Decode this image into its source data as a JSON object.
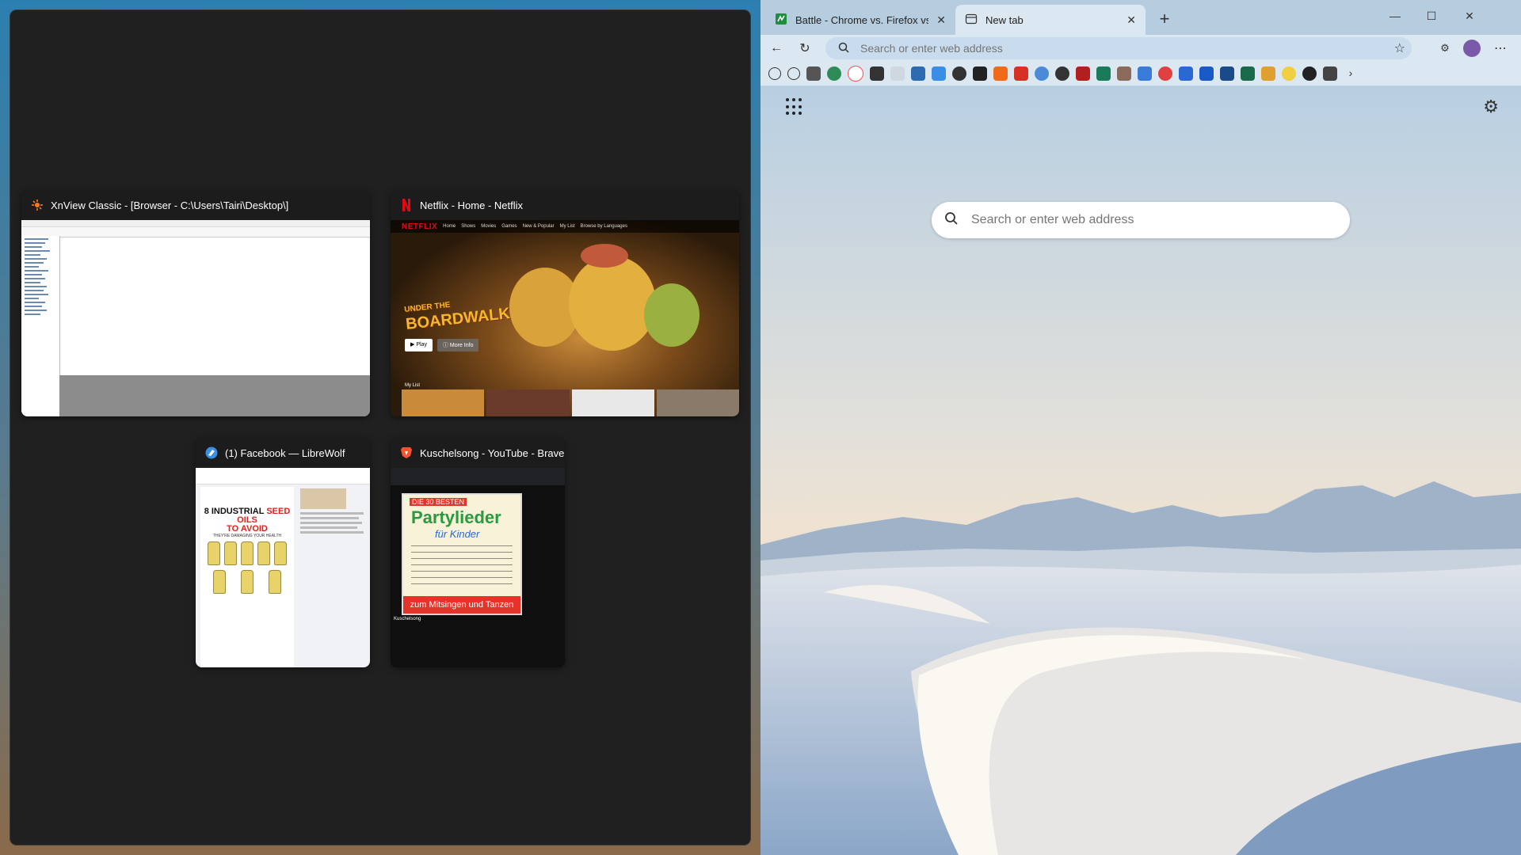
{
  "snap_assist": {
    "windows": [
      {
        "title": "XnView Classic - [Browser - C:\\Users\\Tairi\\Desktop\\]",
        "icon": "xnview-icon"
      },
      {
        "title": "Netflix - Home - Netflix",
        "icon": "netflix-icon"
      },
      {
        "title": "(1) Facebook — LibreWolf",
        "icon": "librewolf-icon"
      },
      {
        "title": "Kuschelsong - YouTube - Brave",
        "icon": "brave-icon"
      }
    ],
    "netflix_thumb": {
      "logo": "NETFLIX",
      "nav": [
        "Home",
        "Shows",
        "Movies",
        "Games",
        "New & Popular",
        "My List",
        "Browse by Languages"
      ],
      "headline_top": "UNDER THE",
      "headline_bottom": "BOARDWALK",
      "play": "▶ Play",
      "more_info": "ⓘ More Info",
      "row_label": "My List"
    },
    "facebook_thumb": {
      "headline_pre": "8 INDUSTRIAL ",
      "headline_red": "SEED OILS",
      "headline_line2": "TO AVOID",
      "subline": "THEY'RE DAMAGING YOUR HEALTH"
    },
    "youtube_thumb": {
      "badge": "DIE 30 BESTEN",
      "title": "Partylieder",
      "subtitle": "für Kinder",
      "footer": "zum Mitsingen und Tanzen",
      "video_title": "Kuschelsong"
    }
  },
  "browser": {
    "tabs": [
      {
        "label": "Battle - Chrome vs. Firefox vs. Ed",
        "active": false
      },
      {
        "label": "New tab",
        "active": true
      }
    ],
    "address_placeholder": "Search or enter web address",
    "newtab_search_placeholder": "Search or enter web address",
    "favorites_count_note": "",
    "colors": {
      "tabbar": "#b6cde0",
      "toolbar": "#dbe7f1",
      "panel": "#202020"
    }
  }
}
